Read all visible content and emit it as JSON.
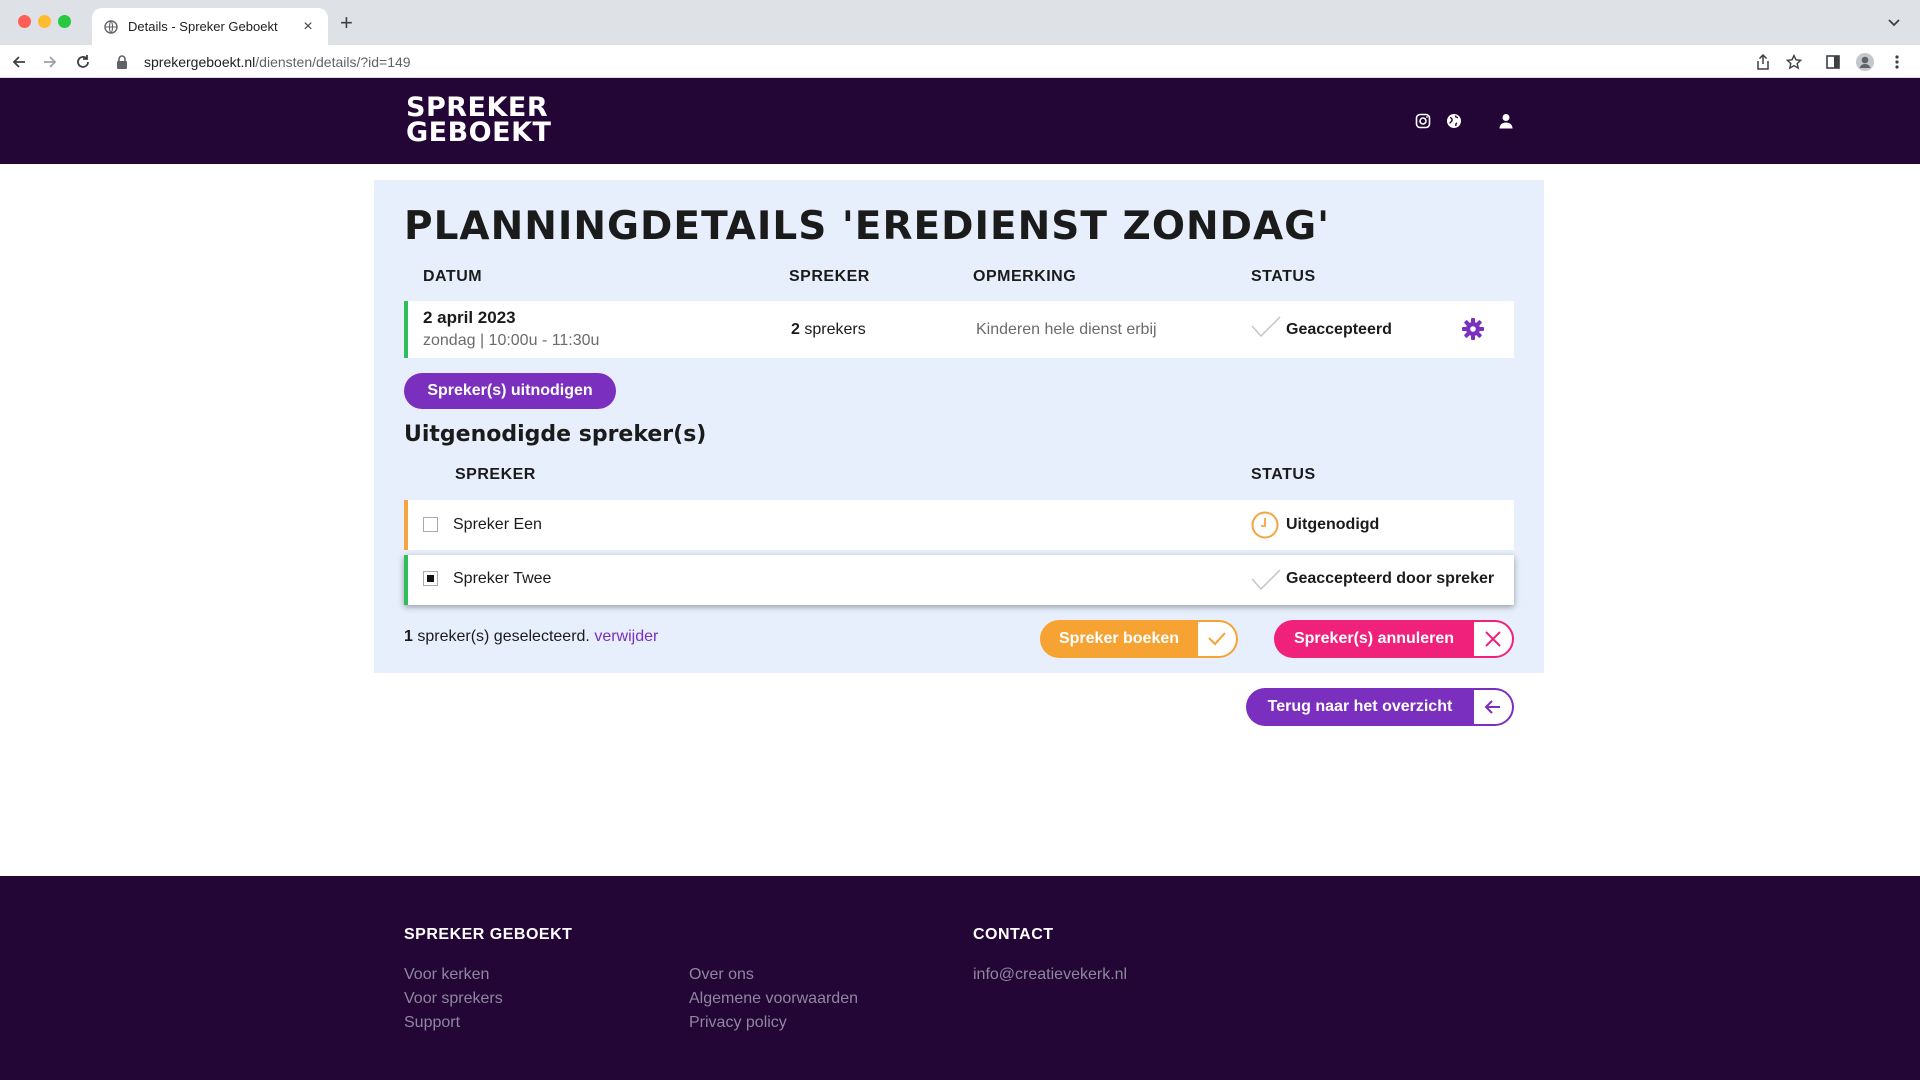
{
  "browser": {
    "tab_title": "Details - Spreker Geboekt",
    "url_domain": "sprekergeboekt.nl",
    "url_path": "/diensten/details/?id=149"
  },
  "site": {
    "logo_line1": "SPREKER",
    "logo_line2": "GEBOEKT"
  },
  "page": {
    "title": "PLANNINGDETAILS 'EREDIENST ZONDAG'",
    "columns": {
      "datum": "DATUM",
      "spreker": "SPREKER",
      "opmerking": "OPMERKING",
      "status": "STATUS"
    },
    "planning": {
      "date": "2 april 2023",
      "time": "zondag | 10:00u - 11:30u",
      "speaker_count": "2",
      "speaker_suffix": " sprekers",
      "remark": "Kinderen hele dienst erbij",
      "status": "Geaccepteerd"
    },
    "invite_button": "Spreker(s) uitnodigen",
    "invited_title": "Uitgenodigde spreker(s)",
    "invited_columns": {
      "spreker": "SPREKER",
      "status": "STATUS"
    },
    "invited": [
      {
        "name": "Spreker Een",
        "status": "Uitgenodigd",
        "checked": false
      },
      {
        "name": "Spreker Twee",
        "status": "Geaccepteerd door spreker",
        "checked": true
      }
    ],
    "selection": {
      "count": "1",
      "text": " spreker(s) geselecteerd. ",
      "remove": "verwijder"
    },
    "book_button": "Spreker boeken",
    "cancel_button": "Spreker(s) annuleren",
    "back_button": "Terug naar het overzicht"
  },
  "footer": {
    "brand_heading": "SPREKER GEBOEKT",
    "contact_heading": "CONTACT",
    "col1": [
      "Voor kerken",
      "Voor sprekers",
      "Support"
    ],
    "col2": [
      "Over ons",
      "Algemene voorwaarden",
      "Privacy policy"
    ],
    "email": "info@creatievekerk.nl"
  },
  "colors": {
    "header_bg": "#230536",
    "panel_bg": "#e7effc",
    "accent_purple": "#7b2fbe",
    "accent_orange": "#f7a334",
    "accent_pink": "#f0217a",
    "accepted_green": "#2fbf5a"
  }
}
